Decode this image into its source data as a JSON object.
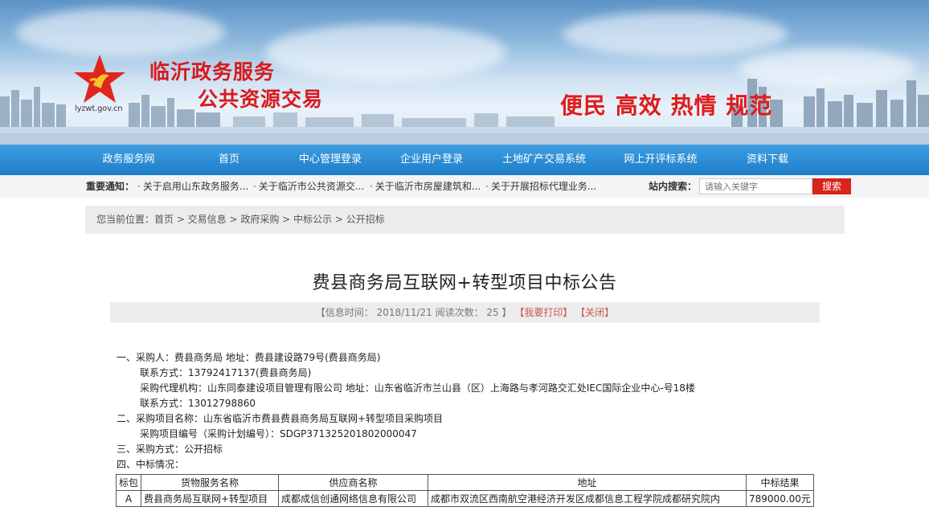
{
  "header": {
    "brand_line1": "临沂政务服务",
    "brand_line2": "公共资源交易",
    "site_url": "lyzwt.gov.cn",
    "slogan": "便民 高效 热情 规范",
    "logo_icon": "red-star-logo-icon",
    "colors": {
      "brand_red": "#d9191c",
      "nav_blue": "#1d7dc9"
    }
  },
  "nav": {
    "items": [
      {
        "label": "政务服务网"
      },
      {
        "label": "首页"
      },
      {
        "label": "中心管理登录"
      },
      {
        "label": "企业用户登录"
      },
      {
        "label": "土地矿产交易系统"
      },
      {
        "label": "网上开评标系统"
      },
      {
        "label": "资料下载"
      }
    ]
  },
  "notice": {
    "label": "重要通知：",
    "items": [
      {
        "text": "关于启用山东政务服务..."
      },
      {
        "text": "关于临沂市公共资源交..."
      },
      {
        "text": "关于临沂市房屋建筑和..."
      },
      {
        "text": "关于开展招标代理业务..."
      }
    ],
    "bullet": "·"
  },
  "search": {
    "label": "站内搜索：",
    "placeholder": "请输入关键字",
    "button": "搜索"
  },
  "breadcrumb": {
    "text": "您当前位置：首页 > 交易信息 > 政府采购 > 中标公示 > 公开招标"
  },
  "article": {
    "title": "费县商务局互联网+转型项目中标公告",
    "meta_prefix": "【信息时间： 2018/11/21 阅读次数： 25 】",
    "print_link": "【我要打印】",
    "close_link": "【关闭】",
    "lines": [
      {
        "text": "一、采购人：费县商务局    地址：费县建设路79号(费县商务局)",
        "indent": false
      },
      {
        "text": "联系方式：13792417137(费县商务局)",
        "indent": true
      },
      {
        "text": "采购代理机构：山东同泰建设项目管理有限公司    地址：山东省临沂市兰山县（区）上海路与孝河路交汇处IEC国际企业中心-号18楼",
        "indent": true
      },
      {
        "text": "联系方式：13012798860",
        "indent": true
      },
      {
        "text": "二、采购项目名称：山东省临沂市费县费县商务局互联网+转型项目采购项目",
        "indent": false
      },
      {
        "text": "采购项目编号（采购计划编号）：SDGP371325201802000047",
        "indent": true
      },
      {
        "text": "三、采购方式：公开招标",
        "indent": false
      },
      {
        "text": "四、中标情况：",
        "indent": false
      }
    ],
    "table": {
      "headers": [
        "标包",
        "货物服务名称",
        "供应商名称",
        "地址",
        "中标结果"
      ],
      "rows": [
        [
          "A",
          "费县商务局互联网+转型项目",
          "成都成信创通网络信息有限公司",
          "成都市双流区西南航空港经济开发区成都信息工程学院成都研究院内",
          "789000.00元"
        ]
      ]
    }
  }
}
